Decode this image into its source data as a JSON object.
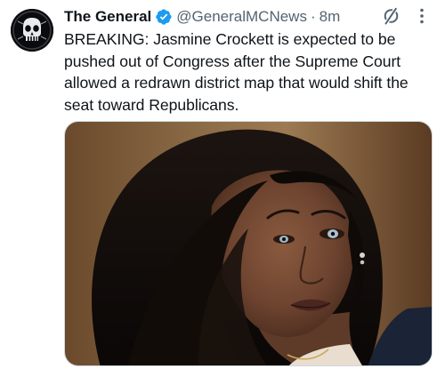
{
  "tweet": {
    "author": {
      "display_name": "The General",
      "handle": "@GeneralMCNews",
      "verified": true,
      "avatar_icon": "skull-emblem-avatar"
    },
    "separator": "·",
    "timestamp": "8m",
    "text": "BREAKING: Jasmine Crockett is expected to be pushed out of Congress after the Supreme Court allowed a redrawn district map that would shift the seat toward Republicans.",
    "media": {
      "type": "photo",
      "icon": "portrait-photo"
    },
    "actions": {
      "grok_icon": "grok-slash-icon",
      "more_icon": "more-options-icon"
    }
  },
  "colors": {
    "text_primary": "#0f1419",
    "text_secondary": "#536471",
    "verified_blue": "#1d9bf0",
    "border": "#cfd9de",
    "background": "#ffffff"
  }
}
